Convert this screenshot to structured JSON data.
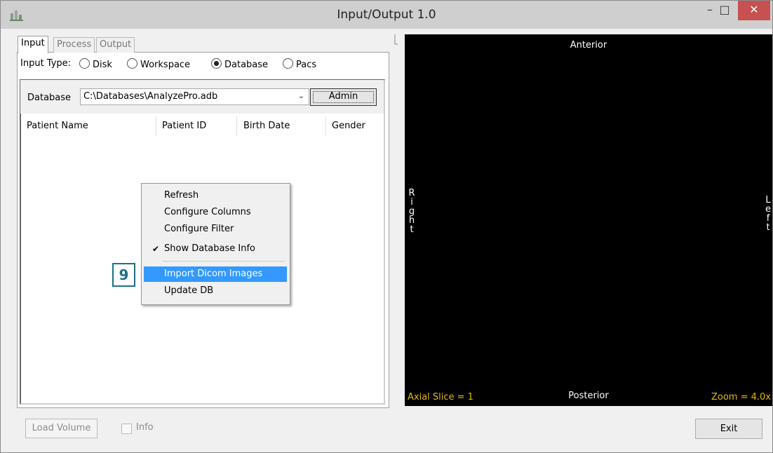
{
  "window": {
    "title": "Input/Output 1.0",
    "min_glyph": "–",
    "max_glyph": "□",
    "close_glyph": "✕"
  },
  "tabs": [
    {
      "label": "Input"
    },
    {
      "label": "Process"
    },
    {
      "label": "Output"
    }
  ],
  "input_type": {
    "label": "Input Type:",
    "options": [
      {
        "label": "Disk"
      },
      {
        "label": "Workspace"
      },
      {
        "label": "Database"
      },
      {
        "label": "Pacs"
      }
    ],
    "selected": "Database"
  },
  "database": {
    "label": "Database",
    "path": "C:\\Databases\\AnalyzePro.adb",
    "admin_label": "Admin"
  },
  "table": {
    "columns": [
      "Patient Name",
      "Patient ID",
      "Birth Date",
      "Gender"
    ],
    "rows": []
  },
  "context_menu": {
    "items": [
      {
        "label": "Refresh"
      },
      {
        "label": "Configure Columns"
      },
      {
        "label": "Configure Filter"
      },
      {
        "label": "Show Database Info",
        "checked": true
      },
      {
        "label": "Import Dicom Images",
        "highlighted": true
      },
      {
        "label": "Update DB"
      }
    ]
  },
  "callout": {
    "number": "9"
  },
  "viewer": {
    "top": "Anterior",
    "bottom": "Posterior",
    "left_side": [
      "R",
      "i",
      "g",
      "h",
      "t"
    ],
    "right_side": [
      "L",
      "e",
      "f",
      "t"
    ],
    "slice": "Axial Slice = 1",
    "zoom": "Zoom = 4.0x"
  },
  "footer": {
    "load_label": "Load Volume",
    "info_label": "Info",
    "exit_label": "Exit"
  },
  "colors": {
    "highlight": "#3399ff",
    "callout": "#1e6f86",
    "overlay_text": "#e6b800",
    "close_button": "#c75050"
  }
}
